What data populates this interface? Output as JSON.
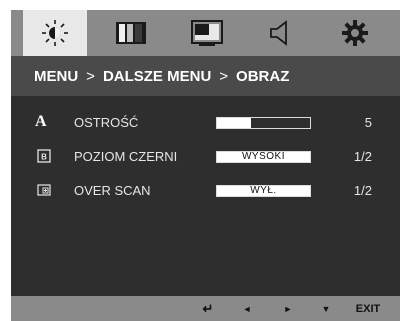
{
  "tabs": [
    {
      "icon": "brightness-icon",
      "active": true
    },
    {
      "icon": "color-icon",
      "active": false
    },
    {
      "icon": "picture-icon",
      "active": false
    },
    {
      "icon": "sound-icon",
      "active": false
    },
    {
      "icon": "settings-icon",
      "active": false
    }
  ],
  "breadcrumb": {
    "menu": "MENU",
    "sep1": ">",
    "sub": "DALSZE MENU",
    "sep2": ">",
    "current": "OBRAZ"
  },
  "settings": [
    {
      "label": "OSTROŚĆ",
      "icon": "sharpness-icon",
      "level_percent": 37,
      "value": "5"
    },
    {
      "label": "POZIOM CZERNI",
      "icon": "black-level-icon",
      "box_text": "WYSOKI",
      "value": "1/2"
    },
    {
      "label": "OVER SCAN",
      "icon": "overscan-icon",
      "box_text": "WYŁ.",
      "value": "1/2"
    }
  ],
  "icon_glyphs": {
    "sharpness": "A"
  },
  "nav": {
    "enter": "↵",
    "left": "◄",
    "right": "►",
    "down": "▼",
    "exit": "EXIT"
  },
  "colors": {
    "osd_background": "#2e2e2e",
    "tab_bar": "#8a8a8a",
    "active_tab": "#e8e8e8",
    "breadcrumb_bar": "#4a4a4a"
  }
}
